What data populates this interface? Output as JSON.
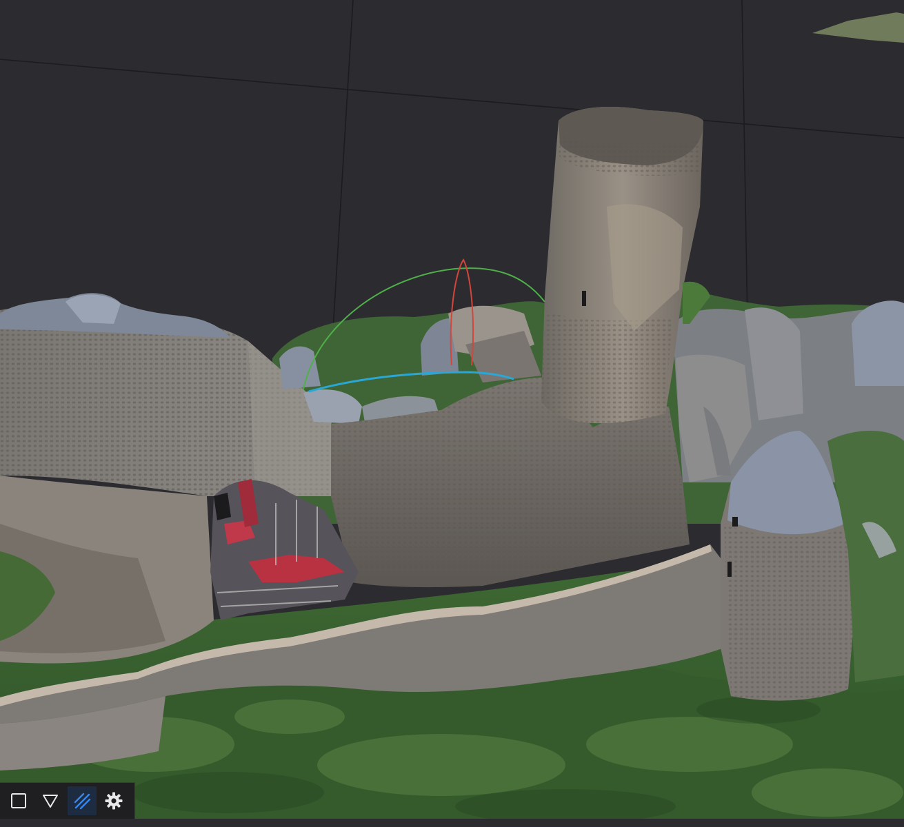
{
  "viewport": {
    "background": "#2c2c30",
    "gizmo_colors": {
      "x": "#d4453a",
      "y": "#4fb04a",
      "z": "#2aa7d6"
    }
  },
  "toolbar": {
    "items": [
      {
        "icon": "square-select-icon",
        "active": false
      },
      {
        "icon": "triangle-filter-icon",
        "active": false
      },
      {
        "icon": "hatch-pattern-icon",
        "active": true
      },
      {
        "icon": "gear-icon",
        "active": false
      }
    ],
    "accent": "#3a86e8"
  }
}
